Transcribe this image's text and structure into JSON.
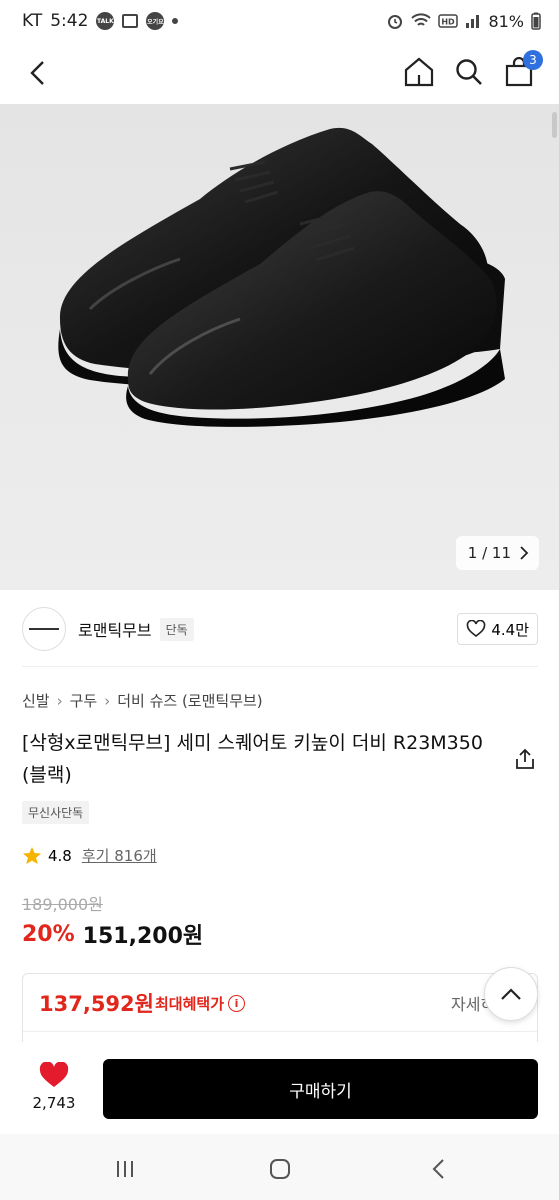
{
  "status": {
    "carrier": "KT",
    "time": "5:42",
    "notif_talk": "TALK",
    "notif_app": "오기요",
    "battery": "81%"
  },
  "nav": {
    "cart_count": "3"
  },
  "gallery": {
    "counter": "1 / 11"
  },
  "brand": {
    "name": "로맨틱무브",
    "tag": "단독",
    "likes": "4.4만"
  },
  "breadcrumb": [
    "신발",
    "구두",
    "더비 슈즈 (로맨틱무브)"
  ],
  "product": {
    "title": "[삭형x로맨틱무브] 세미 스퀘어토 키높이 더비 R23M350 (블랙)",
    "exclusive_tag": "무신사단독",
    "rating": "4.8",
    "reviews": "후기 816개",
    "original_price": "189,000원",
    "discount": "20%",
    "price": "151,200원"
  },
  "benefit": {
    "amount": "137,592원",
    "label": "최대혜택가",
    "info": "i",
    "detail": "자세히"
  },
  "bottom": {
    "like_count": "2,743",
    "buy_label": "구매하기"
  },
  "colors": {
    "accent_red": "#e1261c",
    "badge_blue": "#2f6fde",
    "heart": "#e31b2c"
  }
}
